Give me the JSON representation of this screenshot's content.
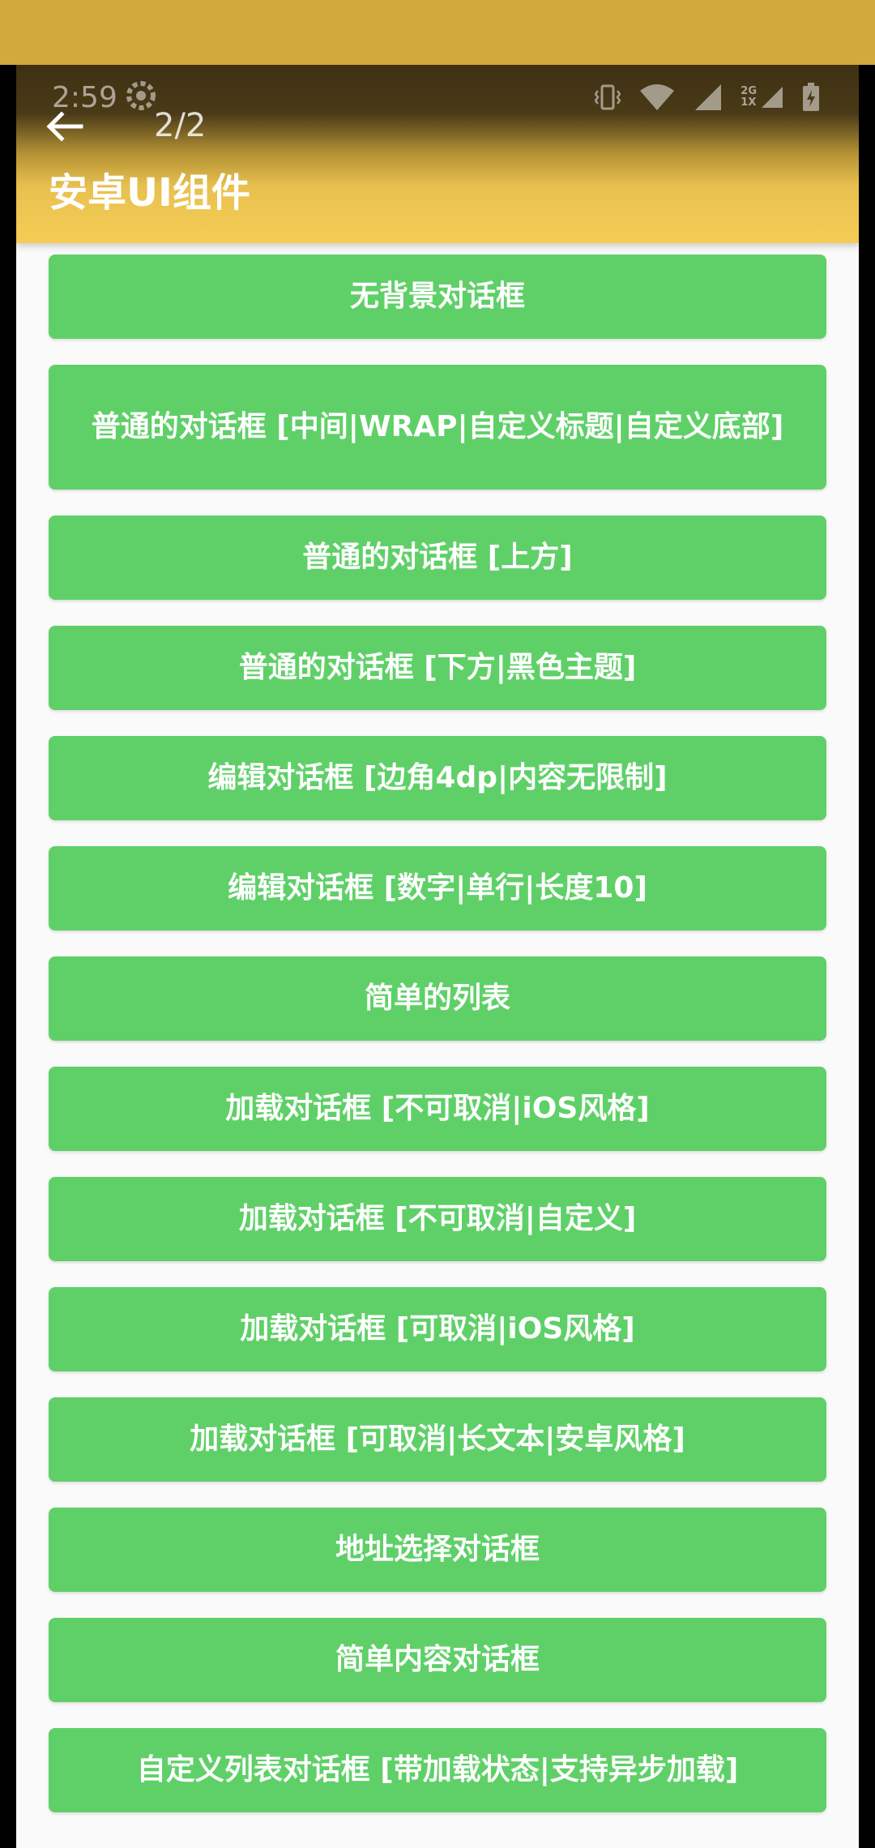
{
  "status_bar": {
    "time": "2:59",
    "icons": [
      "settings-icon",
      "vibrate-icon",
      "wifi-icon",
      "signal-icon",
      "network-2g-icon",
      "signal-2-icon",
      "battery-icon"
    ],
    "network_label_top": "2G",
    "network_label_bottom": "1X"
  },
  "app_bar": {
    "back_icon": "arrow-left-icon",
    "page_indicator": "2/2",
    "title": "安卓UI组件"
  },
  "buttons": [
    {
      "label": "无背景对话框"
    },
    {
      "label": "普通的对话框 [中间|WRAP|自定义标题|自定义底部]"
    },
    {
      "label": "普通的对话框 [上方]"
    },
    {
      "label": "普通的对话框 [下方|黑色主题]"
    },
    {
      "label": "编辑对话框 [边角4dp|内容无限制]"
    },
    {
      "label": "编辑对话框 [数字|单行|长度10]"
    },
    {
      "label": "简单的列表"
    },
    {
      "label": "加载对话框 [不可取消|iOS风格]"
    },
    {
      "label": "加载对话框 [不可取消|自定义]"
    },
    {
      "label": "加载对话框 [可取消|iOS风格]"
    },
    {
      "label": "加载对话框 [可取消|长文本|安卓风格]"
    },
    {
      "label": "地址选择对话框"
    },
    {
      "label": "简单内容对话框"
    },
    {
      "label": "自定义列表对话框 [带加载状态|支持异步加载]"
    }
  ],
  "colors": {
    "app_bar": "#f5cd55",
    "button": "#5fd068",
    "background": "#fafafa",
    "top_band": "#d1aa3b"
  }
}
